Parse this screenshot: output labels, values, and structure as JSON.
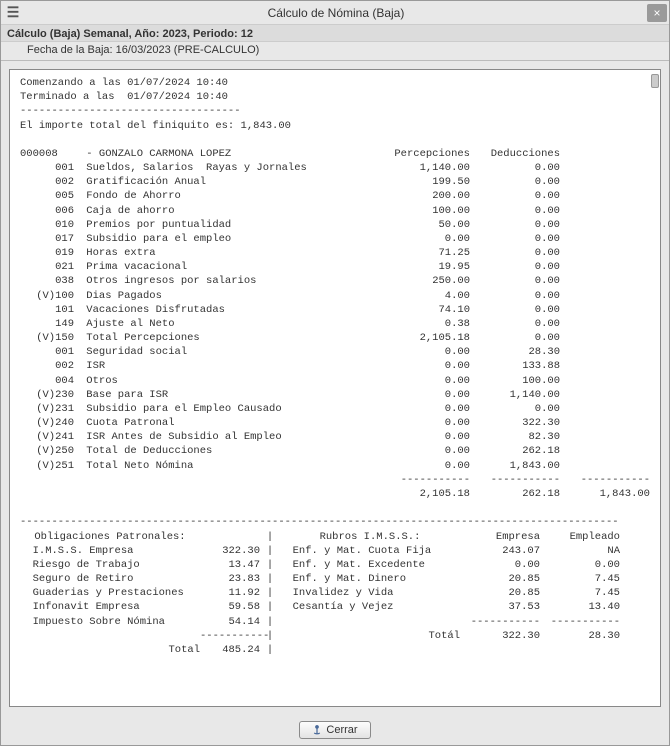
{
  "window": {
    "title": "Cálculo de Nómina (Baja)",
    "menu_glyph": "☰",
    "close_glyph": "×"
  },
  "subheader": "Cálculo (Baja) Semanal, Año: 2023, Periodo: 12",
  "subheader2": "Fecha de la Baja: 16/03/2023 (PRE-CALCULO)",
  "report": {
    "start_line": "Comenzando a las 01/07/2024 10:40",
    "end_line": "Terminado a las  01/07/2024 10:40",
    "dashline": "-----------------------------------",
    "total_line": "El importe total del finiquito es: 1,843.00",
    "employee_id": "000008",
    "employee_sep": " - ",
    "employee_name": "GONZALO CARMONA LOPEZ",
    "col_perc": "Percepciones",
    "col_ded": "Deducciones",
    "lines": [
      {
        "v": "",
        "code": "001",
        "desc": "Sueldos, Salarios  Rayas y Jornales",
        "perc": "1,140.00",
        "ded": "0.00"
      },
      {
        "v": "",
        "code": "002",
        "desc": "Gratificación Anual",
        "perc": "199.50",
        "ded": "0.00"
      },
      {
        "v": "",
        "code": "005",
        "desc": "Fondo de Ahorro",
        "perc": "200.00",
        "ded": "0.00"
      },
      {
        "v": "",
        "code": "006",
        "desc": "Caja de ahorro",
        "perc": "100.00",
        "ded": "0.00"
      },
      {
        "v": "",
        "code": "010",
        "desc": "Premios por puntualidad",
        "perc": "50.00",
        "ded": "0.00"
      },
      {
        "v": "",
        "code": "017",
        "desc": "Subsidio para el empleo",
        "perc": "0.00",
        "ded": "0.00"
      },
      {
        "v": "",
        "code": "019",
        "desc": "Horas extra",
        "perc": "71.25",
        "ded": "0.00"
      },
      {
        "v": "",
        "code": "021",
        "desc": "Prima vacacional",
        "perc": "19.95",
        "ded": "0.00"
      },
      {
        "v": "",
        "code": "038",
        "desc": "Otros ingresos por salarios",
        "perc": "250.00",
        "ded": "0.00"
      },
      {
        "v": "(V)",
        "code": "100",
        "desc": "Dias Pagados",
        "perc": "4.00",
        "ded": "0.00"
      },
      {
        "v": "",
        "code": "101",
        "desc": "Vacaciones Disfrutadas",
        "perc": "74.10",
        "ded": "0.00"
      },
      {
        "v": "",
        "code": "149",
        "desc": "Ajuste al Neto",
        "perc": "0.38",
        "ded": "0.00"
      },
      {
        "v": "(V)",
        "code": "150",
        "desc": "Total Percepciones",
        "perc": "2,105.18",
        "ded": "0.00"
      },
      {
        "v": "",
        "code": "001",
        "desc": "Seguridad social",
        "perc": "0.00",
        "ded": "28.30"
      },
      {
        "v": "",
        "code": "002",
        "desc": "ISR",
        "perc": "0.00",
        "ded": "133.88"
      },
      {
        "v": "",
        "code": "004",
        "desc": "Otros",
        "perc": "0.00",
        "ded": "100.00"
      },
      {
        "v": "(V)",
        "code": "230",
        "desc": "Base para ISR",
        "perc": "0.00",
        "ded": "1,140.00"
      },
      {
        "v": "(V)",
        "code": "231",
        "desc": "Subsidio para el Empleo Causado",
        "perc": "0.00",
        "ded": "0.00"
      },
      {
        "v": "(V)",
        "code": "240",
        "desc": "Cuota Patronal",
        "perc": "0.00",
        "ded": "322.30"
      },
      {
        "v": "(V)",
        "code": "241",
        "desc": "ISR Antes de Subsidio al Empleo",
        "perc": "0.00",
        "ded": "82.30"
      },
      {
        "v": "(V)",
        "code": "250",
        "desc": "Total de Deducciones",
        "perc": "0.00",
        "ded": "262.18"
      },
      {
        "v": "(V)",
        "code": "251",
        "desc": "Total Neto Nómina",
        "perc": "0.00",
        "ded": "1,843.00"
      }
    ],
    "sum_dashes_perc": "-----------",
    "sum_dashes_ded": "-----------",
    "sum_dashes_net": "-----------",
    "sum_perc": "2,105.18",
    "sum_ded": "262.18",
    "sum_net": "1,843.00",
    "big_dash": "-----------------------------------------------------------------------------------------------",
    "oblig_title": "Obligaciones Patronales:",
    "rubros_title": "Rubros I.M.S.S.:",
    "col_empresa": "Empresa",
    "col_empleado": "Empleado",
    "oblig": [
      {
        "label": "I.M.S.S. Empresa",
        "val": "322.30"
      },
      {
        "label": "Riesgo de Trabajo",
        "val": "13.47"
      },
      {
        "label": "Seguro de Retiro",
        "val": "23.83"
      },
      {
        "label": "Guaderias y Prestaciones",
        "val": "11.92"
      },
      {
        "label": "Infonavit Empresa",
        "val": "59.58"
      },
      {
        "label": "Impuesto Sobre Nómina",
        "val": "54.14"
      }
    ],
    "rubros": [
      {
        "label": "Enf. y Mat. Cuota Fija",
        "emp": "243.07",
        "ple": "NA"
      },
      {
        "label": "Enf. y Mat. Excedente",
        "emp": "0.00",
        "ple": "0.00"
      },
      {
        "label": "Enf. y Mat. Dinero",
        "emp": "20.85",
        "ple": "7.45"
      },
      {
        "label": "Invalidez y Vida",
        "emp": "20.85",
        "ple": "7.45"
      },
      {
        "label": "Cesantía y Vejez",
        "emp": "37.53",
        "ple": "13.40"
      }
    ],
    "oblig_dash": "-----------",
    "oblig_total_label": "Total",
    "oblig_total": "485.24",
    "rubros_dash_e": "-----------",
    "rubros_dash_p": "-----------",
    "rubros_total_label": "Totál",
    "rubros_total_e": "322.30",
    "rubros_total_p": "28.30",
    "pipe": "|"
  },
  "footer": {
    "close_label": "Cerrar"
  }
}
